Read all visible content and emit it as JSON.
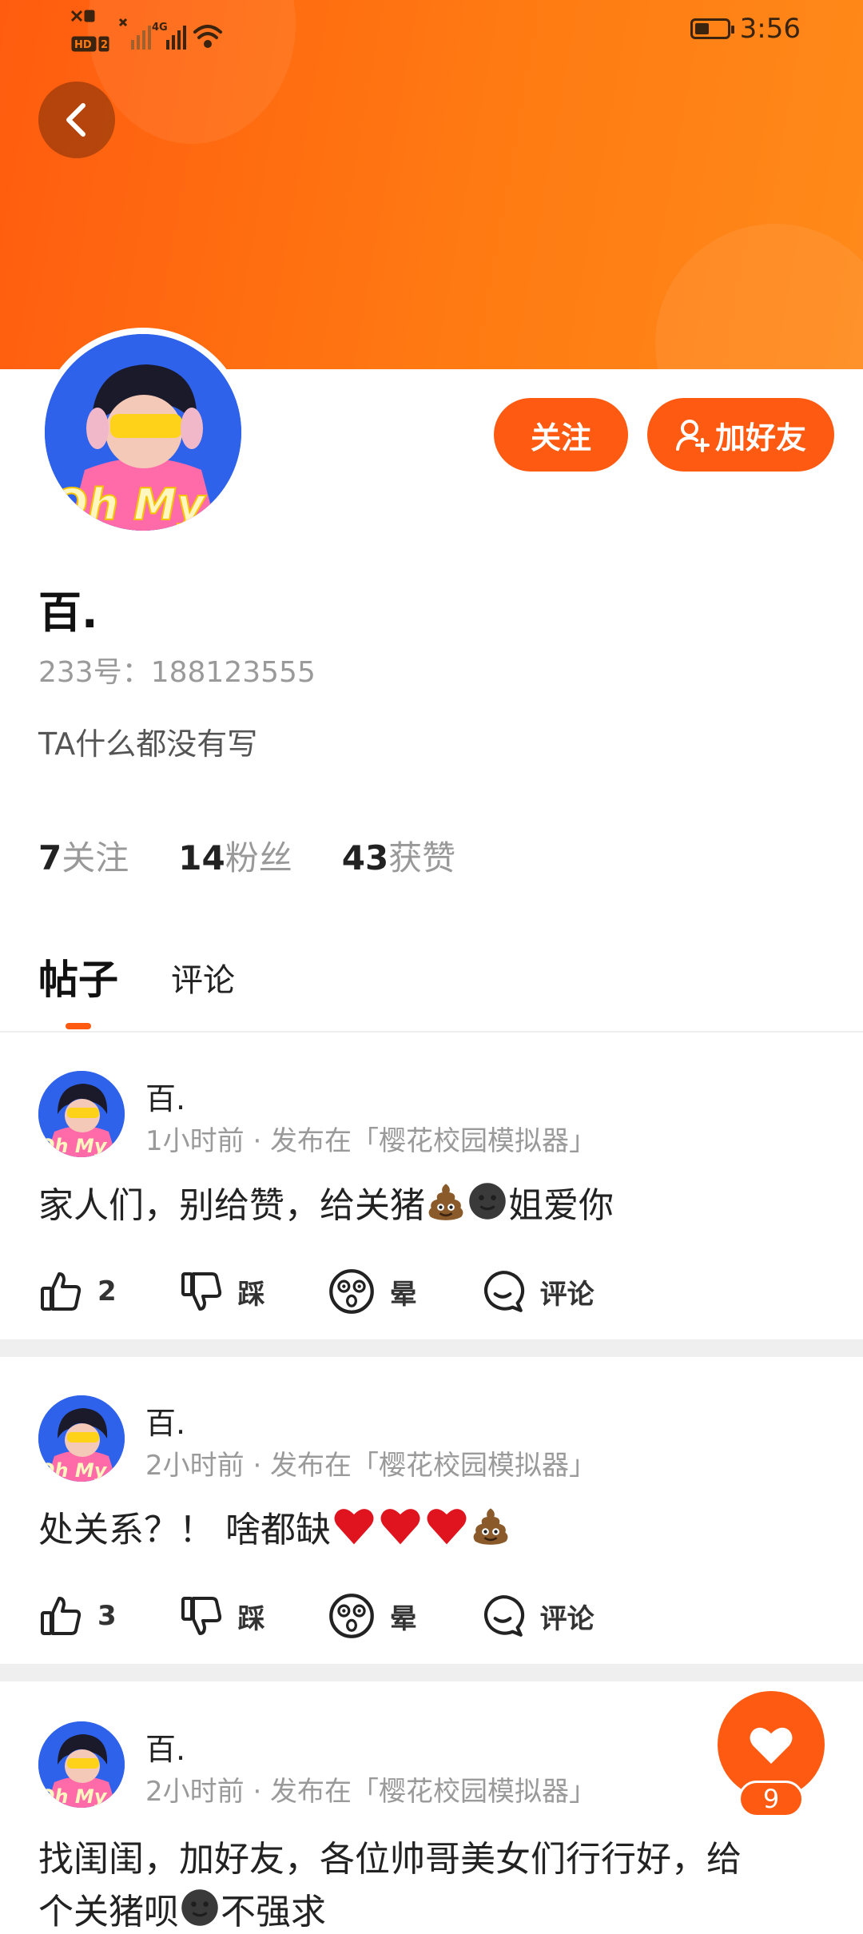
{
  "status_bar": {
    "time": "3:56",
    "network_type": "4G",
    "sim_badge": "HD",
    "sim_slot": "2",
    "battery_level_percent": 45
  },
  "profile": {
    "name": "百.",
    "uid_label": "233号：188123555",
    "bio": "TA什么都没有写",
    "follow_button": "关注",
    "add_friend_button": "加好友",
    "avatar_text": "Oh My",
    "stats": [
      {
        "num": "7",
        "label": "关注"
      },
      {
        "num": "14",
        "label": "粉丝"
      },
      {
        "num": "43",
        "label": "获赞"
      }
    ]
  },
  "tabs": {
    "posts": "帖子",
    "comments": "评论"
  },
  "posts": [
    {
      "author": "百.",
      "meta": "1小时前 · 发布在「樱花校园模拟器」",
      "text_a": "家人们，别给赞，给关猪",
      "text_b": "姐爱你",
      "like_count": "2",
      "dislike_label": "踩",
      "dizzy_label": "晕",
      "comment_label": "评论"
    },
    {
      "author": "百.",
      "meta": "2小时前 · 发布在「樱花校园模拟器」",
      "text_a": "处关系？！ 啥都缺",
      "like_count": "3",
      "dislike_label": "踩",
      "dizzy_label": "晕",
      "comment_label": "评论"
    },
    {
      "author": "百.",
      "meta": "2小时前 · 发布在「樱花校园模拟器」",
      "line1": "找闺闺，加好友，各位帅哥美女们行行好，给",
      "line2_a": "个关猪呗",
      "line2_b": "不强求"
    }
  ],
  "floating_like": {
    "count": "9"
  },
  "colors": {
    "accent": "#ff5a12",
    "header_start": "#ff5c0f",
    "header_end": "#ff8a1a"
  }
}
